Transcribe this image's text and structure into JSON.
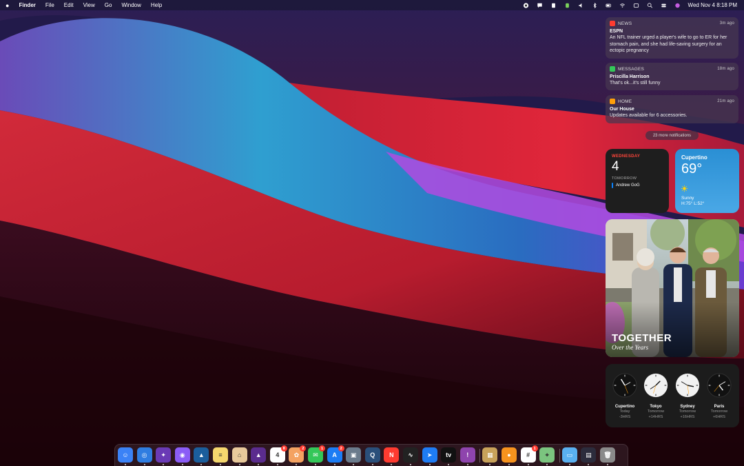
{
  "menubar": {
    "apple_icon": "apple-icon",
    "app_name": "Finder",
    "menus": [
      "File",
      "Edit",
      "View",
      "Go",
      "Window",
      "Help"
    ],
    "datetime": "Wed Nov 4  8:18 PM"
  },
  "notifications": [
    {
      "app": "NEWS",
      "time": "3m ago",
      "title": "ESPN",
      "body": "An NFL trainer urged a player's wife to go to ER for her stomach pain, and she had life-saving surgery for an ectopic pregnancy",
      "color": "#ff3b30"
    },
    {
      "app": "MESSAGES",
      "time": "18m ago",
      "title": "Priscilla Harrison",
      "body": "That's ok...it's still funny",
      "color": "#34c759"
    },
    {
      "app": "HOME",
      "time": "21m ago",
      "title": "Our House",
      "body": "Updates available for 6 accessories.",
      "color": "#ff9f0a"
    }
  ],
  "more_notifications": "23 more notifications",
  "calendar": {
    "day": "WEDNESDAY",
    "date": "4",
    "tomorrow": "TOMORROW",
    "event": "Andrew GoG"
  },
  "weather": {
    "city": "Cupertino",
    "temp": "69°",
    "condition": "Sunny",
    "hilo": "H:75° L:52°"
  },
  "photos": {
    "title": "TOGETHER",
    "subtitle": "Over the Years"
  },
  "clocks": [
    {
      "city": "Cupertino",
      "day": "Today",
      "offset": "-3HRS",
      "dark": true
    },
    {
      "city": "Tokyo",
      "day": "Tomorrow",
      "offset": "+14HRS",
      "dark": false
    },
    {
      "city": "Sydney",
      "day": "Tomorrow",
      "offset": "+16HRS",
      "dark": false
    },
    {
      "city": "Paris",
      "day": "Tomorrow",
      "offset": "+6HRS",
      "dark": true
    }
  ],
  "dock": {
    "apps": [
      {
        "name": "finder-icon",
        "color": "#3b82f6",
        "glyph": "☺"
      },
      {
        "name": "safari-icon",
        "color": "#2f7de1",
        "glyph": "◎"
      },
      {
        "name": "final-cut-icon",
        "color": "#6a3ab5",
        "glyph": "✦"
      },
      {
        "name": "motion-icon",
        "color": "#8b5cf6",
        "glyph": "◉"
      },
      {
        "name": "affinity-designer-icon",
        "color": "#1b5e9c",
        "glyph": "▲"
      },
      {
        "name": "notes-icon",
        "color": "#f5d76e",
        "glyph": "≡"
      },
      {
        "name": "lasso-icon",
        "color": "#e8c99b",
        "glyph": "⌂"
      },
      {
        "name": "affinity-photo-icon",
        "color": "#5b2c8e",
        "glyph": "▲"
      },
      {
        "name": "calendar-icon",
        "color": "#ffffff",
        "glyph": "4",
        "badge": "8"
      },
      {
        "name": "photos-icon",
        "color": "#f4a261",
        "glyph": "✿",
        "badge": "2"
      },
      {
        "name": "messages-icon",
        "color": "#34c759",
        "glyph": "✉",
        "badge": "1"
      },
      {
        "name": "app-store-icon",
        "color": "#1c7cf4",
        "glyph": "A",
        "badge": "2"
      },
      {
        "name": "preview-icon",
        "color": "#6b7b8c",
        "glyph": "▣"
      },
      {
        "name": "quicktime-icon",
        "color": "#2a4f7a",
        "glyph": "Q"
      },
      {
        "name": "news-icon",
        "color": "#ff3b30",
        "glyph": "N"
      },
      {
        "name": "activity-monitor-icon",
        "color": "#222222",
        "glyph": "∿"
      },
      {
        "name": "spark-icon",
        "color": "#1f7cf4",
        "glyph": "➤"
      },
      {
        "name": "apple-tv-icon",
        "color": "#111111",
        "glyph": "tv"
      },
      {
        "name": "feedback-icon",
        "color": "#8e44ad",
        "glyph": "!"
      },
      {
        "name": "pixelmator-icon",
        "color": "#c8a25a",
        "glyph": "▦"
      },
      {
        "name": "tangerine-icon",
        "color": "#f7931e",
        "glyph": "●"
      },
      {
        "name": "slack-icon",
        "color": "#ffffff",
        "glyph": "#",
        "badge": "1"
      },
      {
        "name": "maps-icon",
        "color": "#7bc47f",
        "glyph": "⌖"
      },
      {
        "name": "folder-icon",
        "color": "#5ab0f0",
        "glyph": "▭"
      },
      {
        "name": "downloads-stack-icon",
        "color": "#2c2c3c",
        "glyph": "▤"
      },
      {
        "name": "trash-icon",
        "color": "#8a8a8a",
        "glyph": "🗑"
      }
    ]
  }
}
